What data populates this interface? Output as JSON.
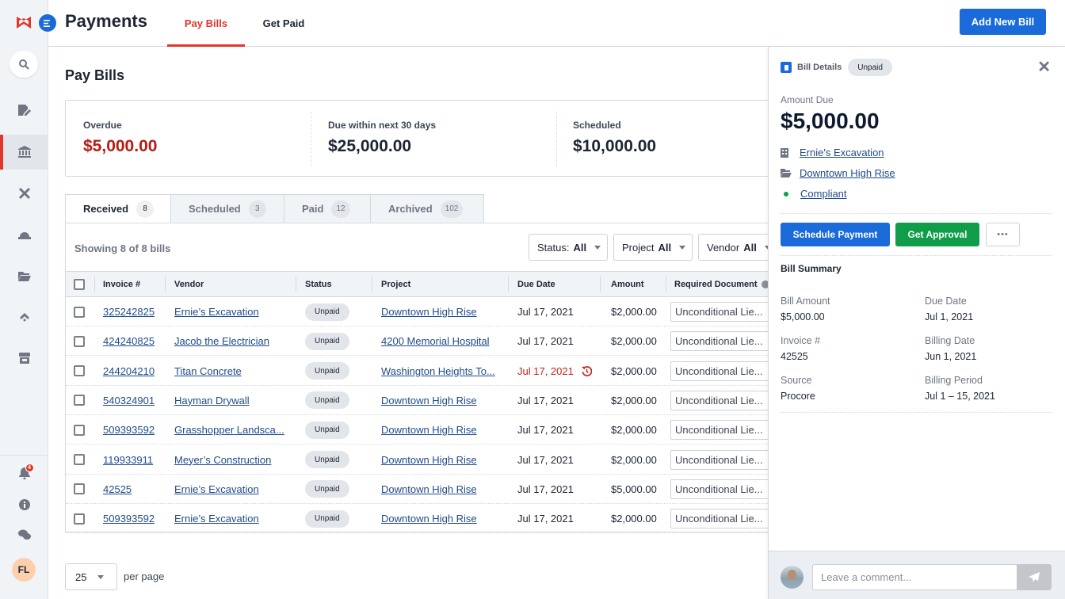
{
  "app": {
    "title": "Payments",
    "tabs": [
      {
        "label": "Pay Bills",
        "active": true
      },
      {
        "label": "Get Paid",
        "active": false
      }
    ],
    "add_button": "Add New Bill",
    "accent_color": "#e0362c",
    "primary_color": "#1a6bd9"
  },
  "sidebar": {
    "items": [
      {
        "icon": "search-icon"
      },
      {
        "icon": "document-edit-icon"
      },
      {
        "icon": "bank-icon",
        "active": true
      },
      {
        "icon": "tools-icon"
      },
      {
        "icon": "hard-hat-icon"
      },
      {
        "icon": "folder-open-icon"
      },
      {
        "icon": "chevron-up-icon"
      },
      {
        "icon": "store-icon"
      }
    ],
    "notifications_count": "4",
    "user_initials": "FL"
  },
  "page": {
    "title": "Pay Bills",
    "summary": [
      {
        "label": "Overdue",
        "value": "$5,000.00",
        "color": "#b71c14"
      },
      {
        "label": "Due within next 30 days",
        "value": "$25,000.00"
      },
      {
        "label": "Scheduled",
        "value": "$10,000.00"
      }
    ],
    "tabs": [
      {
        "label": "Received",
        "count": "8",
        "active": true
      },
      {
        "label": "Scheduled",
        "count": "3"
      },
      {
        "label": "Paid",
        "count": "12"
      },
      {
        "label": "Archived",
        "count": "102"
      }
    ],
    "showing": "Showing 8 of 8 bills",
    "filters": [
      {
        "label": "Status:",
        "value": "All"
      },
      {
        "label": "Project",
        "value": "All"
      },
      {
        "label": "Vendor",
        "value": "All"
      }
    ],
    "columns": [
      "Invoice #",
      "Vendor",
      "Status",
      "Project",
      "Due Date",
      "Amount",
      "Required Document"
    ],
    "rows": [
      {
        "invoice": "325242825",
        "vendor": "Ernie’s Excavation",
        "status": "Unpaid",
        "project": "Downtown High Rise",
        "due": "Jul 17, 2021",
        "amount": "$2,000.00",
        "doc": "Unconditional Lie..."
      },
      {
        "invoice": "424240825",
        "vendor": "Jacob the Electrician",
        "status": "Unpaid",
        "project": "4200 Memorial Hospital",
        "due": "Jul 17, 2021",
        "amount": "$2,000.00",
        "doc": "Unconditional Lie..."
      },
      {
        "invoice": "244204210",
        "vendor": "Titan Concrete",
        "status": "Unpaid",
        "project": "Washington Heights To...",
        "due": "Jul 17, 2021",
        "amount": "$2,000.00",
        "doc": "Unconditional Lie...",
        "overdue": true
      },
      {
        "invoice": "540324901",
        "vendor": "Hayman Drywall",
        "status": "Unpaid",
        "project": "Downtown High Rise",
        "due": "Jul 17, 2021",
        "amount": "$2,000.00",
        "doc": "Unconditional Lie..."
      },
      {
        "invoice": "509393592",
        "vendor": "Grasshopper Landsca...",
        "status": "Unpaid",
        "project": "Downtown High Rise",
        "due": "Jul 17, 2021",
        "amount": "$2,000.00",
        "doc": "Unconditional Lie..."
      },
      {
        "invoice": "119933911",
        "vendor": "Meyer’s Construction",
        "status": "Unpaid",
        "project": "Downtown High Rise",
        "due": "Jul 17, 2021",
        "amount": "$2,000.00",
        "doc": "Unconditional Lie..."
      },
      {
        "invoice": "42525",
        "vendor": "Ernie’s Excavation",
        "status": "Unpaid",
        "project": "Downtown High Rise",
        "due": "Jul 17, 2021",
        "amount": "$5,000.00",
        "doc": "Unconditional Lie..."
      },
      {
        "invoice": "509393592",
        "vendor": "Ernie’s Excavation",
        "status": "Unpaid",
        "project": "Downtown High Rise",
        "due": "Jul 17, 2021",
        "amount": "$2,000.00",
        "doc": "Unconditional Lie..."
      }
    ],
    "per_page_value": "25",
    "per_page_label": "per page"
  },
  "drawer": {
    "title": "Bill Details",
    "status": "Unpaid",
    "amount_label": "Amount Due",
    "amount": "$5,000.00",
    "vendor": "Ernie's Excavation",
    "project": "Downtown High Rise",
    "compliance": "Compliant",
    "schedule_button": "Schedule Payment",
    "approval_button": "Get Approval",
    "more_button": "•••",
    "summary_title": "Bill Summary",
    "summary": [
      {
        "label": "Bill Amount",
        "value": "$5,000.00"
      },
      {
        "label": "Due Date",
        "value": "Jul 1, 2021"
      },
      {
        "label": "Invoice #",
        "value": "42525"
      },
      {
        "label": "Billing Date",
        "value": "Jun 1, 2021"
      },
      {
        "label": "Source",
        "value": "Procore"
      },
      {
        "label": "Billing Period",
        "value": "Jul 1 – 15, 2021"
      }
    ],
    "comment_placeholder": "Leave a comment..."
  }
}
